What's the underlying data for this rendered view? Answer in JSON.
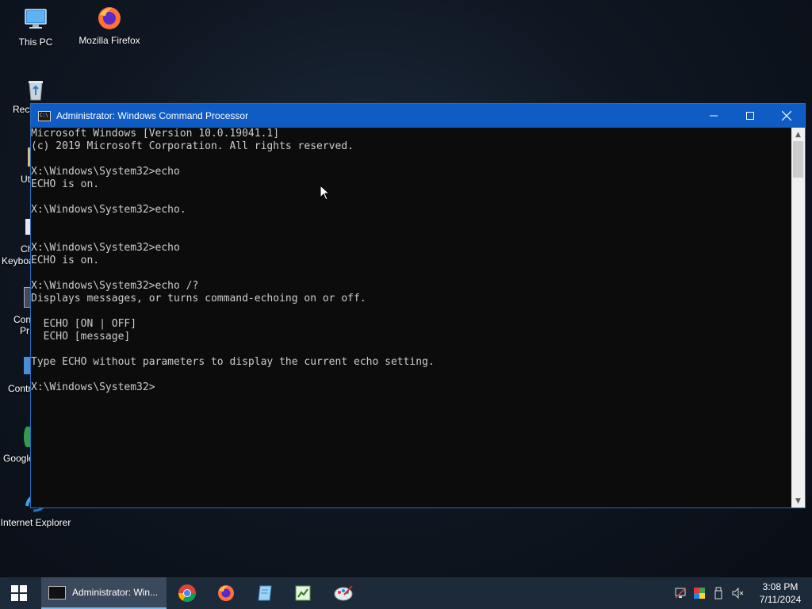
{
  "desktop": {
    "icons": [
      {
        "name": "This PC",
        "icon": "computer-icon"
      },
      {
        "name": "Mozilla Firefox",
        "icon": "firefox-icon"
      },
      {
        "name": "Internet Explorer",
        "icon": "internet-explorer-icon"
      }
    ],
    "partial_labels": [
      "Recy",
      "Ut",
      "Ch",
      "Keyboa",
      "Con",
      "Pr",
      "Contr",
      "Google"
    ]
  },
  "window": {
    "title": "Administrator: Windows Command Processor",
    "app_icon": "cmd-icon",
    "controls": [
      "minimize",
      "maximize",
      "close"
    ]
  },
  "console": {
    "lines": [
      "Microsoft Windows [Version 10.0.19041.1]",
      "(c) 2019 Microsoft Corporation. All rights reserved.",
      "",
      "X:\\Windows\\System32>echo",
      "ECHO is on.",
      "",
      "X:\\Windows\\System32>echo.",
      "",
      "",
      "X:\\Windows\\System32>echo",
      "ECHO is on.",
      "",
      "X:\\Windows\\System32>echo /?",
      "Displays messages, or turns command-echoing on or off.",
      "",
      "  ECHO [ON | OFF]",
      "  ECHO [message]",
      "",
      "Type ECHO without parameters to display the current echo setting.",
      "",
      "X:\\Windows\\System32>"
    ]
  },
  "taskbar": {
    "active_task_label": "Administrator: Win...",
    "pinned": [
      "chrome-icon",
      "firefox-icon",
      "notepad-icon",
      "spreadsheet-icon",
      "paint-icon"
    ],
    "tray_icons": [
      "network-icon",
      "color-icon",
      "usb-icon",
      "volume-muted-icon"
    ],
    "clock_time": "3:08 PM",
    "clock_date": "7/11/2024"
  },
  "colors": {
    "titlebar": "#0e5cc4",
    "console_bg": "#0c0c0c",
    "console_text": "#cccccc",
    "taskbar": "#1c2a3a"
  }
}
